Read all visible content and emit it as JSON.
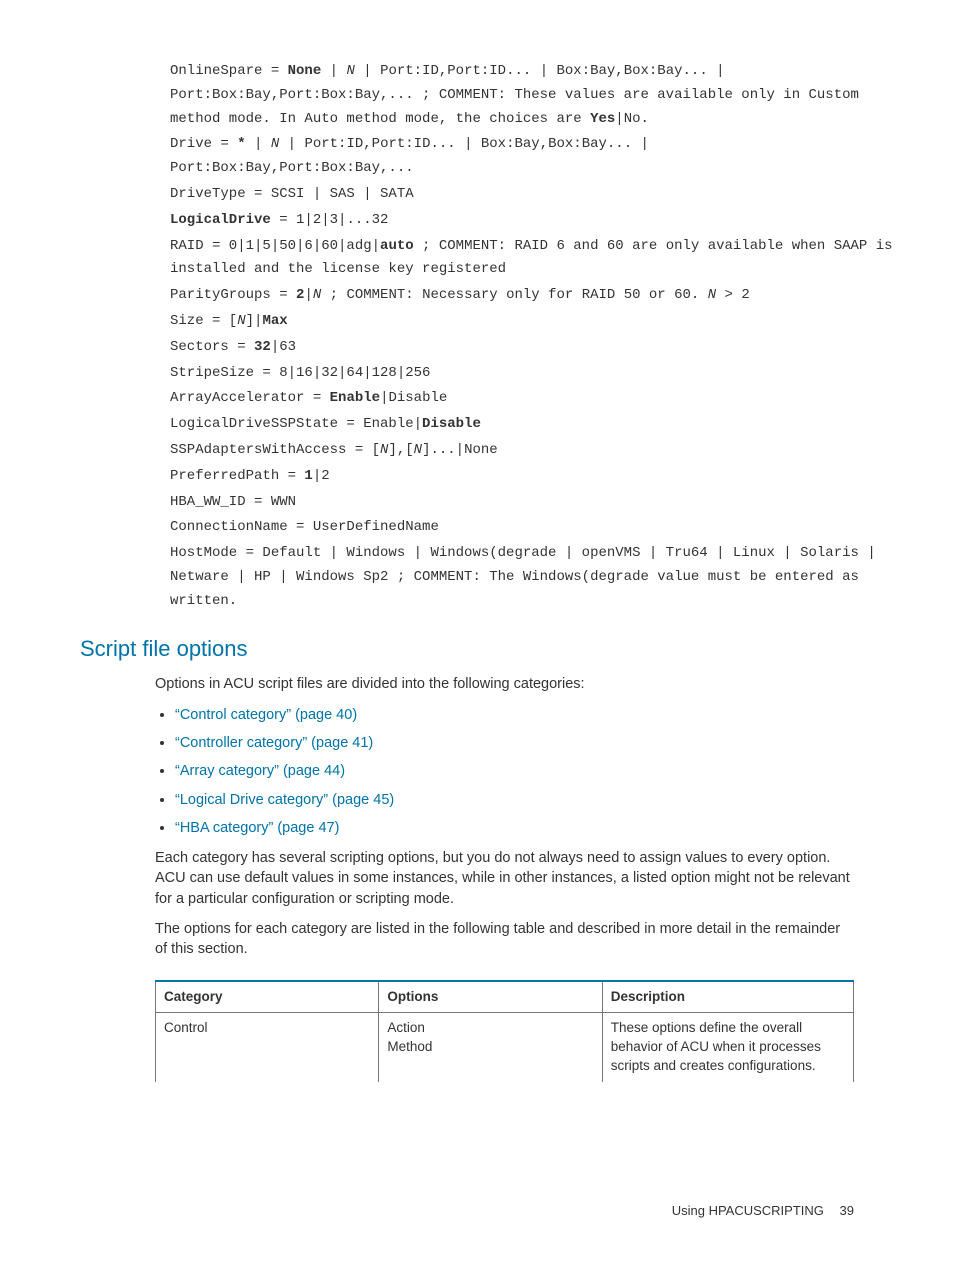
{
  "code": {
    "l1a": "OnlineSpare = ",
    "l1b": "None",
    "l1c": " | ",
    "l1d": "N",
    "l1e": " | Port:ID,Port:ID... | Box:Bay,Box:Bay... | Port:Box:Bay,Port:Box:Bay,... ; COMMENT: These values are available only in Custom method mode. In Auto method mode, the choices are ",
    "l1f": "Yes",
    "l1g": "|No.",
    "l2a": "Drive = ",
    "l2b": "*",
    "l2c": " | ",
    "l2d": "N",
    "l2e": " | Port:ID,Port:ID... | Box:Bay,Box:Bay... | Port:Box:Bay,Port:Box:Bay,...",
    "l3": "DriveType = SCSI | SAS | SATA",
    "l4a": "LogicalDrive",
    "l4b": " = 1|2|3|...32",
    "l5a": "RAID = 0|1|5|50|6|60|adg|",
    "l5b": "auto",
    "l5c": " ; COMMENT: RAID 6 and 60 are only available when SAAP is installed and the license key registered",
    "l6a": "ParityGroups = ",
    "l6b": "2",
    "l6c": "|",
    "l6d": "N",
    "l6e": " ; COMMENT: Necessary only for RAID 50 or 60. ",
    "l6f": "N",
    "l6g": " > 2",
    "l7a": "Size = [",
    "l7b": "N",
    "l7c": "]|",
    "l7d": "Max",
    "l8a": "Sectors = ",
    "l8b": "32",
    "l8c": "|63",
    "l9": "StripeSize = 8|16|32|64|128|256",
    "l10a": "ArrayAccelerator = ",
    "l10b": "Enable",
    "l10c": "|Disable",
    "l11a": "LogicalDriveSSPState = Enable|",
    "l11b": "Disable",
    "l12a": "SSPAdaptersWithAccess = [",
    "l12b": "N",
    "l12c": "],[",
    "l12d": "N",
    "l12e": "]...|None",
    "l13a": "PreferredPath = ",
    "l13b": "1",
    "l13c": "|2",
    "l14": "HBA_WW_ID = WWN",
    "l15": "ConnectionName = UserDefinedName",
    "l16": "HostMode = Default | Windows | Windows(degrade | openVMS | Tru64 | Linux | Solaris | Netware | HP | Windows Sp2 ; COMMENT: The Windows(degrade value must be entered as written."
  },
  "heading": "Script file options",
  "intro": "Options in ACU script files are divided into the following categories:",
  "links": {
    "a": "“Control category” (page 40)",
    "b": "“Controller category” (page 41)",
    "c": "“Array category” (page 44)",
    "d": "“Logical Drive category” (page 45)",
    "e": "“HBA category” (page 47)"
  },
  "para1": "Each category has several scripting options, but you do not always need to assign values to every option. ACU can use default values in some instances, while in other instances, a listed option might not be relevant for a particular configuration or scripting mode.",
  "para2": "The options for each category are listed in the following table and described in more detail in the remainder of this section.",
  "table": {
    "h1": "Category",
    "h2": "Options",
    "h3": "Description",
    "r1c1": "Control",
    "r1c2a": "Action",
    "r1c2b": "Method",
    "r1c3": "These options define the overall behavior of ACU when it processes scripts and creates configurations."
  },
  "footer": {
    "text": "Using HPACUSCRIPTING",
    "page": "39"
  }
}
